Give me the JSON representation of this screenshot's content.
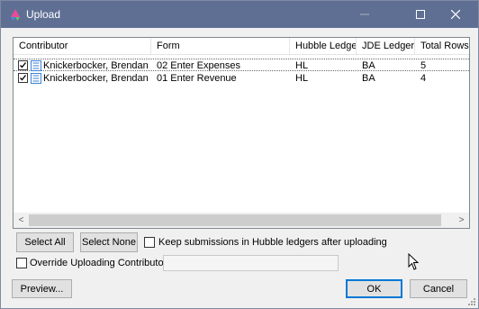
{
  "window": {
    "title": "Upload"
  },
  "titlebar": {
    "minimize": "minimize",
    "maximize": "maximize",
    "close": "close"
  },
  "table": {
    "columns": [
      "Contributor",
      "Form",
      "Hubble Ledger",
      "JDE Ledger",
      "Total Rows"
    ],
    "rows": [
      {
        "checked": true,
        "contributor": "Knickerbocker, Brendan",
        "form": "02 Enter Expenses",
        "hubble": "HL",
        "jde": "BA",
        "total": "5"
      },
      {
        "checked": true,
        "contributor": "Knickerbocker, Brendan",
        "form": "01 Enter Revenue",
        "hubble": "HL",
        "jde": "BA",
        "total": "4"
      }
    ],
    "scroll_left": "<",
    "scroll_right": ">"
  },
  "buttons": {
    "select_all": "Select All",
    "select_none": "Select None",
    "preview": "Preview...",
    "ok": "OK",
    "cancel": "Cancel"
  },
  "options": {
    "keep_submissions": {
      "label": "Keep submissions in Hubble ledgers after uploading",
      "checked": false
    },
    "override_contributor": {
      "label": "Override Uploading Contributor",
      "checked": false,
      "value": ""
    }
  },
  "colors": {
    "titlebar": "#5f6f94",
    "accent": "#0078d7"
  }
}
